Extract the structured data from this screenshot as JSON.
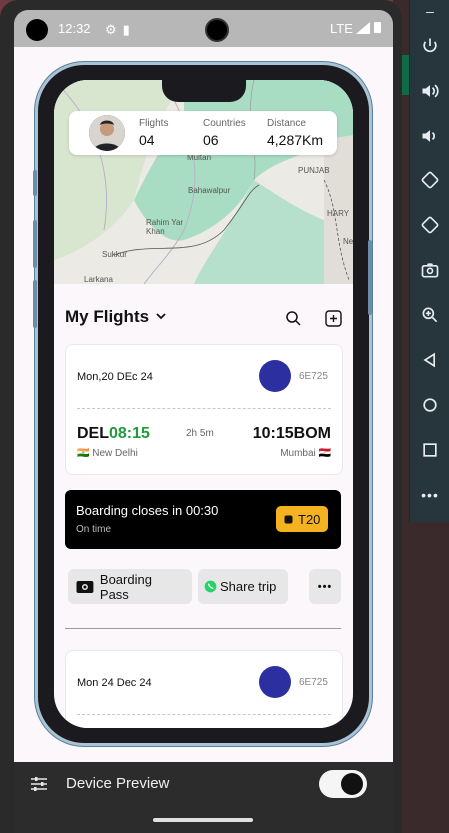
{
  "status_bar": {
    "time": "12:32",
    "network": "LTE"
  },
  "stats": [
    {
      "label": "Flights",
      "value": "04"
    },
    {
      "label": "Countries",
      "value": "06"
    },
    {
      "label": "Distance",
      "value": "4,287Km"
    }
  ],
  "map_labels": [
    "Multan",
    "PUNJAB",
    "Bahawalpur",
    "Rahim Yar Khan",
    "Sukkur",
    "HARY",
    "Ne",
    "Larkana"
  ],
  "section_title": "My Flights",
  "flights": [
    {
      "date": "Mon,20 DEc 24",
      "flight_no": "6E725",
      "dep_code": "DEL",
      "dep_time": "08:15",
      "duration": "2h 5m",
      "arr_time": "10:15",
      "arr_code": "BOM",
      "dep_city": "New Delhi",
      "arr_city": "Mumbai",
      "dep_flag": "🇮🇳",
      "arr_flag": "🇪🇬"
    },
    {
      "date": "Mon 24 Dec 24",
      "flight_no": "6E725"
    }
  ],
  "boarding": {
    "message": "Boarding closes in 00:30",
    "status": "On time",
    "terminal": "T20"
  },
  "actions": {
    "boarding_pass": "Boarding Pass",
    "share_trip": "Share trip",
    "more": "•••"
  },
  "device_preview": {
    "label": "Device Preview",
    "enabled": true
  },
  "colors": {
    "accent_green": "#1e9c3c",
    "terminal_badge": "#f4b221",
    "airline_logo": "#2b2fa0"
  }
}
